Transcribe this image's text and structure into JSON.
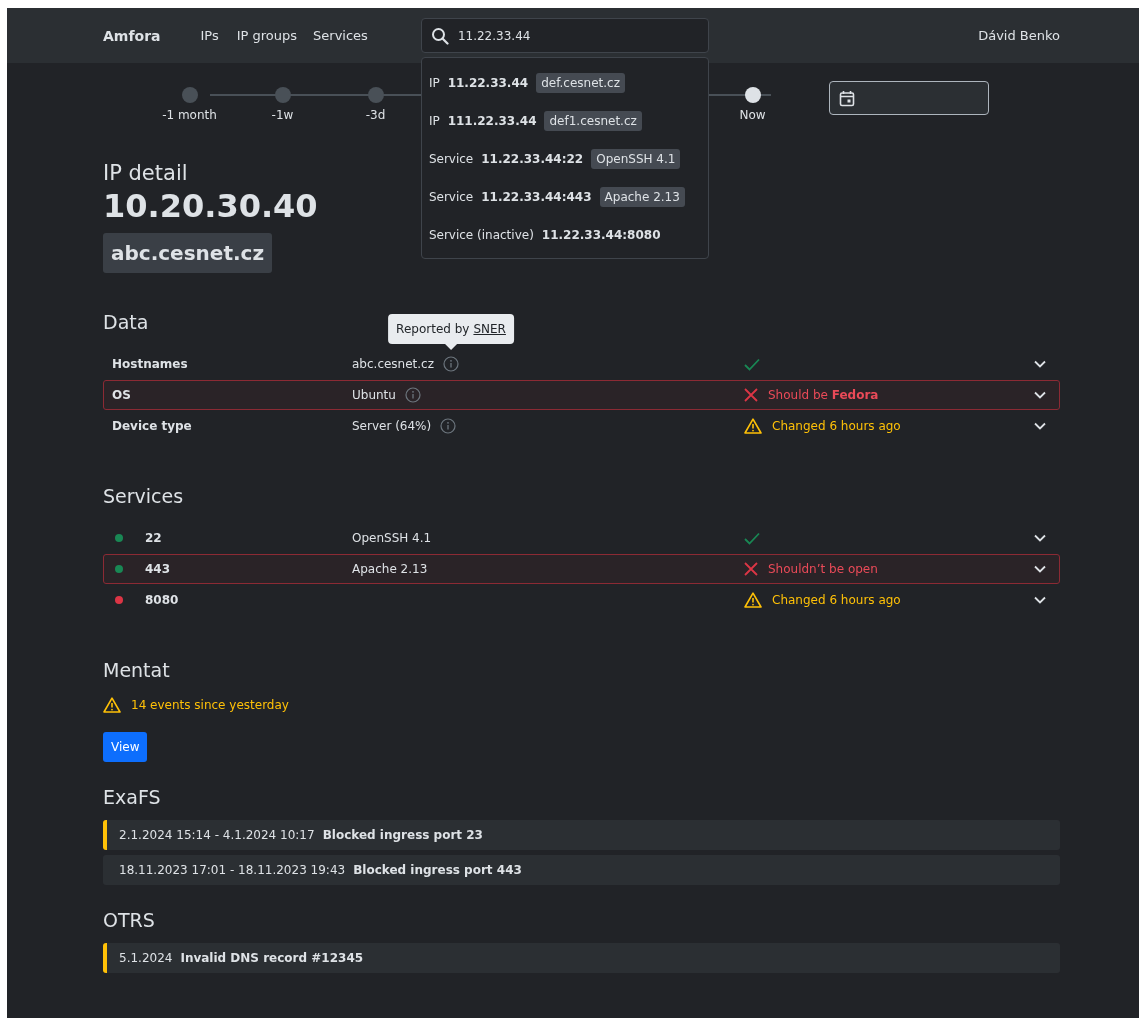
{
  "navbar": {
    "brand": "Amfora",
    "links": [
      "IPs",
      "IP groups",
      "Services"
    ],
    "search": {
      "value": "11.22.33.44"
    },
    "user": "Dávid Benko"
  },
  "search_results": [
    {
      "type": "IP",
      "address": "11.22.33.44",
      "tag": "def.cesnet.cz"
    },
    {
      "type": "IP",
      "address": "111.22.33.44",
      "tag": "def1.cesnet.cz"
    },
    {
      "type": "Service",
      "address": "11.22.33.44:22",
      "tag": "OpenSSH 4.1"
    },
    {
      "type": "Service",
      "address": "11.22.33.44:443",
      "tag": "Apache 2.13"
    },
    {
      "type": "Service (inactive)",
      "address": "11.22.33.44:8080"
    }
  ],
  "timeline": [
    {
      "label": "-1 month",
      "selected": false
    },
    {
      "label": "-1w",
      "selected": false
    },
    {
      "label": "-3d",
      "selected": false
    },
    {
      "label": "Now",
      "selected": true
    }
  ],
  "header": {
    "title": "IP detail",
    "ip": "10.20.30.40",
    "hostname": "abc.cesnet.cz"
  },
  "data": {
    "title": "Data",
    "tooltip": {
      "text": "Reported by",
      "link": "SNER"
    },
    "rows": [
      {
        "label": "Hostnames",
        "value": "abc.cesnet.cz",
        "status": {
          "kind": "ok"
        },
        "alert": false
      },
      {
        "label": "OS",
        "value": "Ubuntu",
        "status": {
          "kind": "error",
          "text": "Should be **Fedora**"
        },
        "alert": true
      },
      {
        "label": "Device type",
        "value": "Server (64%)",
        "status": {
          "kind": "warning",
          "text": "Changed 6 hours ago"
        },
        "alert": false
      }
    ]
  },
  "services": {
    "title": "Services",
    "rows": [
      {
        "port": "22",
        "color": "#198754",
        "name": "OpenSSH 4.1",
        "status": {
          "kind": "ok"
        },
        "alert": false
      },
      {
        "port": "443",
        "color": "#198754",
        "name": "Apache 2.13",
        "status": {
          "kind": "error",
          "text": "Shouldn’t be open"
        },
        "alert": true
      },
      {
        "port": "8080",
        "color": "#dc3545",
        "status": {
          "kind": "warning",
          "text": "Changed 6 hours ago"
        },
        "alert": false
      }
    ]
  },
  "mentat": {
    "title": "Mentat",
    "warning": "14 events since yesterday",
    "button": "View"
  },
  "exafs": {
    "title": "ExaFS",
    "items": [
      {
        "time": "2.1.2024 15:14 - 4.1.2024 10:17",
        "text": "Blocked ingress port 23",
        "highlighted": true
      },
      {
        "time": "18.11.2023 17:01 - 18.11.2023 19:43",
        "text": "Blocked ingress port 443",
        "highlighted": false
      }
    ]
  },
  "otrs": {
    "title": "OTRS",
    "items": [
      {
        "time": "5.1.2024",
        "text": "Invalid DNS record #12345",
        "highlighted": true
      }
    ]
  }
}
